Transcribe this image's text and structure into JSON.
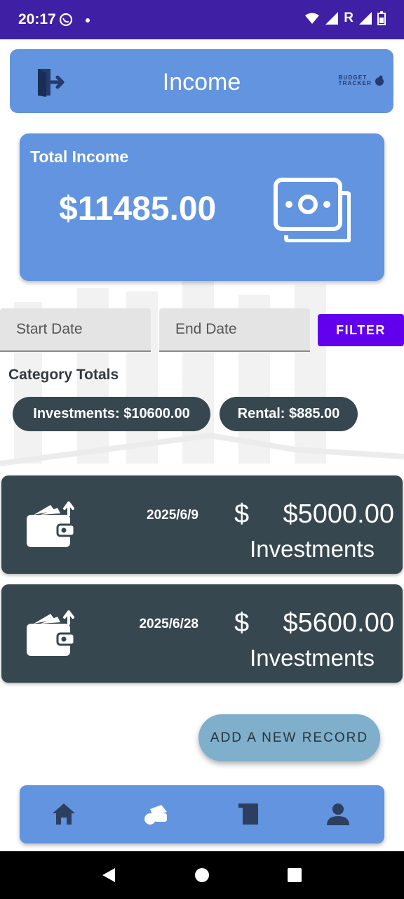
{
  "status_bar": {
    "time": "20:17",
    "network_label": "R"
  },
  "header": {
    "title": "Income",
    "logo_line1": "BUDGET",
    "logo_line2": "TRACKER"
  },
  "total_card": {
    "label": "Total Income",
    "amount": "$11485.00"
  },
  "filters": {
    "start_placeholder": "Start Date",
    "end_placeholder": "End Date",
    "filter_label": "FILTER"
  },
  "categories": {
    "heading": "Category Totals",
    "chips": [
      "Investments: $10600.00",
      "Rental: $885.00"
    ]
  },
  "records": [
    {
      "date": "2025/6/9",
      "currency": "$",
      "amount": "$5000.00",
      "category": "Investments"
    },
    {
      "date": "2025/6/28",
      "currency": "$",
      "amount": "$5600.00",
      "category": "Investments"
    }
  ],
  "add_button": {
    "label": "ADD A NEW RECORD"
  },
  "bottom_nav": {
    "items": [
      "home-icon",
      "income-icon",
      "records-icon",
      "profile-icon"
    ]
  },
  "colors": {
    "status_bar": "#3f1fa3",
    "primary_blue": "#6294df",
    "dark_card": "#37474f",
    "filter_purple": "#6200ee",
    "add_button": "#7fafcb"
  }
}
